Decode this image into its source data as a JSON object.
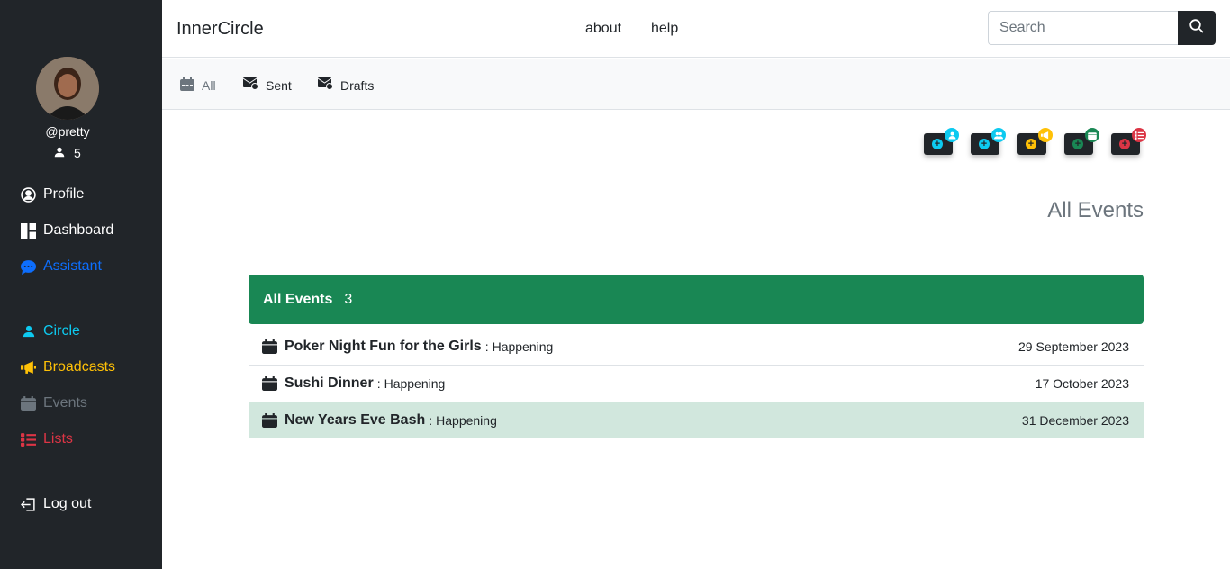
{
  "app": {
    "brand": "InnerCircle"
  },
  "topnav": {
    "about": "about",
    "help": "help",
    "search_placeholder": "Search"
  },
  "user": {
    "handle": "@pretty",
    "circle_count": "5"
  },
  "sidebar": {
    "items": [
      {
        "label": "Profile",
        "icon": "user-circle-icon",
        "color": "#ffffff"
      },
      {
        "label": "Dashboard",
        "icon": "dashboard-icon",
        "color": "#ffffff"
      },
      {
        "label": "Assistant",
        "icon": "chat-icon",
        "color": "#0d6efd"
      },
      {
        "label": "Circle",
        "icon": "person-icon",
        "color": "#0dcaf0"
      },
      {
        "label": "Broadcasts",
        "icon": "megaphone-icon",
        "color": "#ffc107"
      },
      {
        "label": "Events",
        "icon": "calendar-icon",
        "color": "#6c757d"
      },
      {
        "label": "Lists",
        "icon": "list-icon",
        "color": "#dc3545"
      },
      {
        "label": "Log out",
        "icon": "logout-icon",
        "color": "#ffffff"
      }
    ]
  },
  "subnav": {
    "all": "All",
    "sent": "Sent",
    "drafts": "Drafts"
  },
  "actions": [
    {
      "icon": "add-person-icon",
      "color": "#0dcaf0"
    },
    {
      "icon": "add-group-icon",
      "color": "#0dcaf0"
    },
    {
      "icon": "add-broadcast-icon",
      "color": "#ffc107"
    },
    {
      "icon": "add-event-icon",
      "color": "#198754"
    },
    {
      "icon": "add-list-icon",
      "color": "#dc3545"
    }
  ],
  "main": {
    "heading": "All Events"
  },
  "events": {
    "header": "All Events",
    "count": "3",
    "rows": [
      {
        "name": "Poker Night Fun for the Girls",
        "sep": ":",
        "status": "Happening",
        "date": "29 September 2023"
      },
      {
        "name": "Sushi Dinner",
        "sep": ":",
        "status": "Happening",
        "date": "17 October 2023"
      },
      {
        "name": "New Years Eve Bash",
        "sep": ":",
        "status": "Happening",
        "date": "31 December 2023"
      }
    ]
  },
  "colors": {
    "sidebar_bg": "#212529",
    "success": "#198754",
    "success_light": "#d1e7dd"
  }
}
